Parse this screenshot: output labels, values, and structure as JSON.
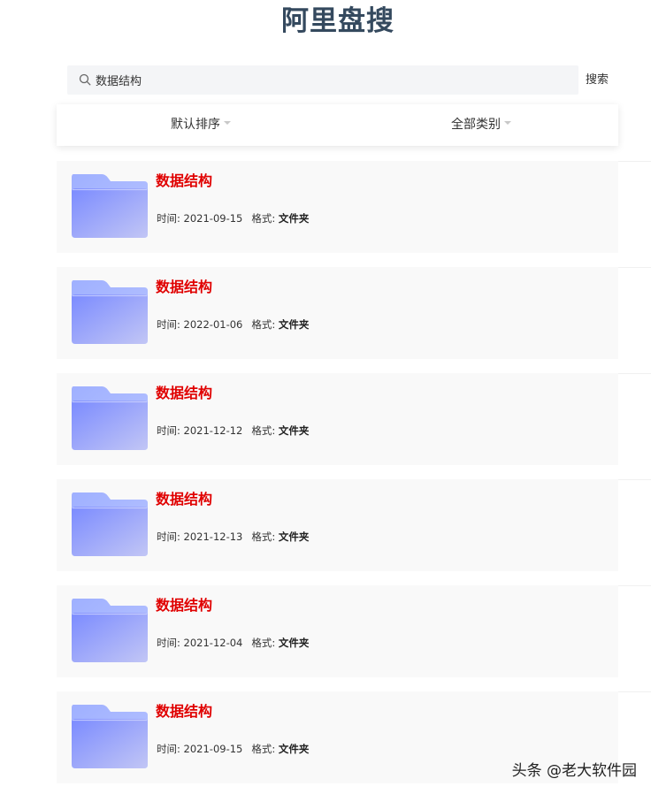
{
  "header": {
    "title": "阿里盘搜"
  },
  "search": {
    "value": "数据结构",
    "placeholder": "",
    "button_label": "搜索",
    "icon": "search-icon"
  },
  "filters": {
    "sort_label": "默认排序",
    "category_label": "全部类别"
  },
  "results": [
    {
      "title": "数据结构",
      "time_label": "时间:",
      "time": "2021-09-15",
      "format_label": "格式:",
      "format": "文件夹",
      "icon": "folder-icon"
    },
    {
      "title": "数据结构",
      "time_label": "时间:",
      "time": "2022-01-06",
      "format_label": "格式:",
      "format": "文件夹",
      "icon": "folder-icon"
    },
    {
      "title": "数据结构",
      "time_label": "时间:",
      "time": "2021-12-12",
      "format_label": "格式:",
      "format": "文件夹",
      "icon": "folder-icon"
    },
    {
      "title": "数据结构",
      "time_label": "时间:",
      "time": "2021-12-13",
      "format_label": "格式:",
      "format": "文件夹",
      "icon": "folder-icon"
    },
    {
      "title": "数据结构",
      "time_label": "时间:",
      "time": "2021-12-04",
      "format_label": "格式:",
      "format": "文件夹",
      "icon": "folder-icon"
    },
    {
      "title": "数据结构",
      "time_label": "时间:",
      "time": "2021-09-15",
      "format_label": "格式:",
      "format": "文件夹",
      "icon": "folder-icon"
    }
  ],
  "watermark": {
    "text": "头条 @老大软件园"
  },
  "colors": {
    "title": "#34495e",
    "result_title": "#e00000",
    "card_background": "#f9f9f9",
    "search_background": "#f4f5f7",
    "folder_light": "#aab2ff",
    "folder_dark": "#7b86f7"
  }
}
